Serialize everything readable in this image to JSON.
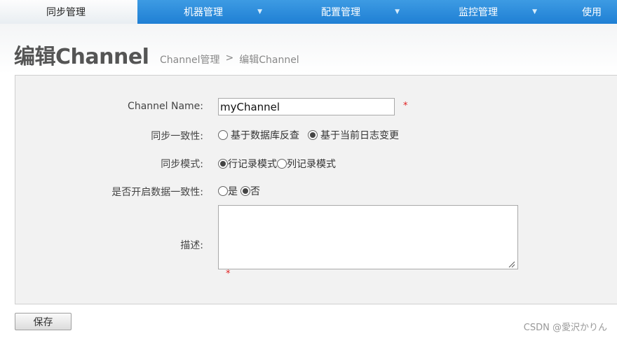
{
  "nav": {
    "items": [
      {
        "label": "同步管理",
        "has_caret": false,
        "active": true
      },
      {
        "label": "机器管理",
        "has_caret": true,
        "active": false
      },
      {
        "label": "配置管理",
        "has_caret": true,
        "active": false
      },
      {
        "label": "监控管理",
        "has_caret": true,
        "active": false
      },
      {
        "label": "使用",
        "has_caret": false,
        "active": false
      }
    ],
    "caret": "▼"
  },
  "page": {
    "title": "编辑Channel",
    "breadcrumb": [
      "Channel管理",
      ">",
      "编辑Channel"
    ]
  },
  "form": {
    "channel_name": {
      "label": "Channel Name:",
      "value": "myChannel",
      "required_mark": "*"
    },
    "consistency": {
      "label": "同步一致性:",
      "options": [
        {
          "label": "基于数据库反查",
          "checked": false
        },
        {
          "label": "基于当前日志变更",
          "checked": true
        }
      ]
    },
    "sync_mode": {
      "label": "同步模式:",
      "options": [
        {
          "label": "行记录模式",
          "checked": true
        },
        {
          "label": "列记录模式",
          "checked": false
        }
      ]
    },
    "enable_consistency": {
      "label": "是否开启数据一致性:",
      "options": [
        {
          "label": "是",
          "checked": false
        },
        {
          "label": "否",
          "checked": true
        }
      ]
    },
    "description": {
      "label": "描述:",
      "value": "",
      "required_mark": "*"
    }
  },
  "actions": {
    "save_label": "保存"
  },
  "watermark": "CSDN @愛沢かりん",
  "colors": {
    "nav_blue": "#1f7fd4",
    "required_red": "#e02020"
  }
}
